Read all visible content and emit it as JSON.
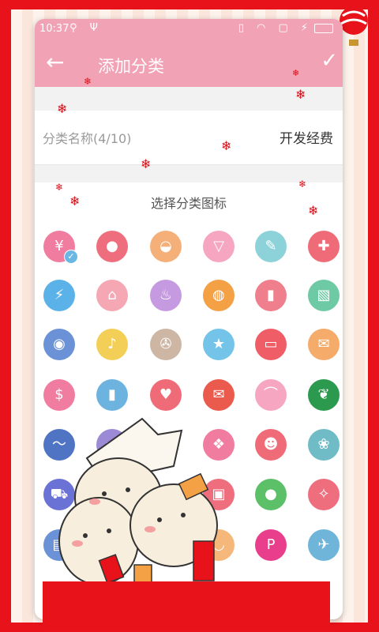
{
  "status_bar": {
    "time": "10:37",
    "left_icons": [
      "usb-icon",
      "usb-debug-icon"
    ],
    "right_icons": [
      "vibrate-icon",
      "wifi-icon",
      "sim-icon",
      "charging-icon",
      "battery-icon"
    ]
  },
  "toolbar": {
    "title": "添加分类",
    "color": "#f2a2b5"
  },
  "category_name": {
    "label": "分类名称(4/10)",
    "value": "开发经费"
  },
  "icon_section": {
    "title": "选择分类图标",
    "selected_icon": "yen-icon",
    "rows": [
      [
        {
          "name": "yen-icon",
          "color": "#f07da0",
          "glyph": "¥"
        },
        {
          "name": "cookie-icon",
          "color": "#ee6e7e",
          "glyph": "●"
        },
        {
          "name": "hat-icon",
          "color": "#f5b07a",
          "glyph": "◒"
        },
        {
          "name": "underwear-icon",
          "color": "#f6a6c1",
          "glyph": "▽"
        },
        {
          "name": "pencil-icon",
          "color": "#8dd2d9",
          "glyph": "✎"
        },
        {
          "name": "first-aid-icon",
          "color": "#f06b78",
          "glyph": "✚"
        }
      ],
      [
        {
          "name": "water-drop-icon",
          "color": "#5bb2e8",
          "glyph": "⚡"
        },
        {
          "name": "house-icon",
          "color": "#f5a7b4",
          "glyph": "⌂"
        },
        {
          "name": "cupcake-icon",
          "color": "#c69ae0",
          "glyph": "♨"
        },
        {
          "name": "basketball-icon",
          "color": "#f3a144",
          "glyph": "◍"
        },
        {
          "name": "lipstick-icon",
          "color": "#ef7f8c",
          "glyph": "▮"
        },
        {
          "name": "tissue-icon",
          "color": "#6dcaa5",
          "glyph": "▧"
        }
      ],
      [
        {
          "name": "camera-icon",
          "color": "#6b91d6",
          "glyph": "◉"
        },
        {
          "name": "microphone-icon",
          "color": "#f4cf57",
          "glyph": "♪"
        },
        {
          "name": "wrench-icon",
          "color": "#cdb7a4",
          "glyph": "✇"
        },
        {
          "name": "star-icon",
          "color": "#74c3e9",
          "glyph": "★"
        },
        {
          "name": "card-icon",
          "color": "#ef5e67",
          "glyph": "▭"
        },
        {
          "name": "red-packet-icon",
          "color": "#f5ab6a",
          "glyph": "✉"
        }
      ],
      [
        {
          "name": "money-bag-icon",
          "color": "#f07da0",
          "glyph": "$"
        },
        {
          "name": "bar-chart-icon",
          "color": "#6db3e0",
          "glyph": "▮"
        },
        {
          "name": "heart-icon",
          "color": "#f06b78",
          "glyph": "♥"
        },
        {
          "name": "envelope-icon",
          "color": "#ea5a4d",
          "glyph": "✉"
        },
        {
          "name": "high-heel-icon",
          "color": "#f6a6c1",
          "glyph": "⌒"
        },
        {
          "name": "leaf-badge-icon",
          "color": "#2c9a4e",
          "glyph": "❦"
        }
      ],
      [
        {
          "name": "line-chart-icon",
          "color": "#4f74c4",
          "glyph": "〜"
        },
        {
          "name": "tv-icon",
          "color": "#9d8ad6",
          "glyph": "▭"
        },
        {
          "name": "hidden-icon",
          "color": "#f07da0",
          "glyph": ""
        },
        {
          "name": "gift-icon",
          "color": "#f07da0",
          "glyph": "❖"
        },
        {
          "name": "mask-icon",
          "color": "#f06b78",
          "glyph": "☻"
        },
        {
          "name": "fish-icon",
          "color": "#6fbcc6",
          "glyph": "❀"
        }
      ],
      [
        {
          "name": "cart-icon",
          "color": "#6b72d6",
          "glyph": "⛟"
        },
        {
          "name": "hidden-icon",
          "color": "#f5a7b4",
          "glyph": ""
        },
        {
          "name": "hidden-icon",
          "color": "#f5a7b4",
          "glyph": ""
        },
        {
          "name": "bus-icon",
          "color": "#ef6e7e",
          "glyph": "▣"
        },
        {
          "name": "apple-icon",
          "color": "#5cc068",
          "glyph": "●"
        },
        {
          "name": "party-icon",
          "color": "#ef6e7e",
          "glyph": "✧"
        }
      ],
      [
        {
          "name": "film-icon",
          "color": "#6b91d6",
          "glyph": "▤"
        },
        {
          "name": "hidden-icon",
          "color": "#f07da0",
          "glyph": ""
        },
        {
          "name": "hidden-icon",
          "color": "#f07da0",
          "glyph": ""
        },
        {
          "name": "lips-icon",
          "color": "#f5b87a",
          "glyph": "◡"
        },
        {
          "name": "p-badge-icon",
          "color": "#e83e8c",
          "glyph": "P"
        },
        {
          "name": "airplane-icon",
          "color": "#6fb5d9",
          "glyph": "✈"
        }
      ]
    ]
  }
}
